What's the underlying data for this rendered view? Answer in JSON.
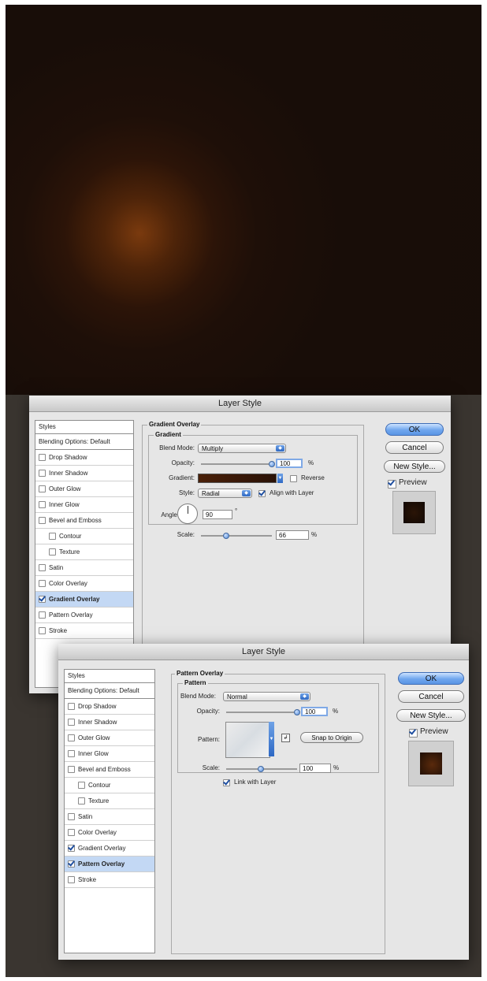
{
  "dialog1": {
    "title": "Layer Style",
    "sidebar": {
      "header": "Styles",
      "blending": "Blending Options: Default",
      "items": [
        {
          "label": "Drop Shadow",
          "checked": false
        },
        {
          "label": "Inner Shadow",
          "checked": false
        },
        {
          "label": "Outer Glow",
          "checked": false
        },
        {
          "label": "Inner Glow",
          "checked": false
        },
        {
          "label": "Bevel and Emboss",
          "checked": false
        },
        {
          "label": "Contour",
          "checked": false
        },
        {
          "label": "Texture",
          "checked": false
        },
        {
          "label": "Satin",
          "checked": false
        },
        {
          "label": "Color Overlay",
          "checked": false
        },
        {
          "label": "Gradient Overlay",
          "checked": true
        },
        {
          "label": "Pattern Overlay",
          "checked": false
        },
        {
          "label": "Stroke",
          "checked": false
        }
      ]
    },
    "section_title": "Gradient Overlay",
    "subsection_title": "Gradient",
    "blend_mode_label": "Blend Mode:",
    "blend_mode_value": "Multiply",
    "opacity_label": "Opacity:",
    "opacity_value": "100",
    "percent": "%",
    "gradient_label": "Gradient:",
    "reverse_label": "Reverse",
    "style_label": "Style:",
    "style_value": "Radial",
    "align_label": "Align with Layer",
    "angle_label": "Angle:",
    "angle_value": "90",
    "degree": "°",
    "scale_label": "Scale:",
    "scale_value": "66",
    "ok_label": "OK",
    "cancel_label": "Cancel",
    "new_style_label": "New Style...",
    "preview_label": "Preview"
  },
  "dialog2": {
    "title": "Layer Style",
    "sidebar": {
      "header": "Styles",
      "blending": "Blending Options: Default",
      "items": [
        {
          "label": "Drop Shadow",
          "checked": false
        },
        {
          "label": "Inner Shadow",
          "checked": false
        },
        {
          "label": "Outer Glow",
          "checked": false
        },
        {
          "label": "Inner Glow",
          "checked": false
        },
        {
          "label": "Bevel and Emboss",
          "checked": false
        },
        {
          "label": "Contour",
          "checked": false
        },
        {
          "label": "Texture",
          "checked": false
        },
        {
          "label": "Satin",
          "checked": false
        },
        {
          "label": "Color Overlay",
          "checked": false
        },
        {
          "label": "Gradient Overlay",
          "checked": true
        },
        {
          "label": "Pattern Overlay",
          "checked": true
        },
        {
          "label": "Stroke",
          "checked": false
        }
      ]
    },
    "section_title": "Pattern Overlay",
    "subsection_title": "Pattern",
    "blend_mode_label": "Blend Mode:",
    "blend_mode_value": "Normal",
    "opacity_label": "Opacity:",
    "opacity_value": "100",
    "percent": "%",
    "pattern_label": "Pattern:",
    "snap_label": "Snap to Origin",
    "scale_label": "Scale:",
    "scale_value": "100",
    "link_label": "Link with Layer",
    "ok_label": "OK",
    "cancel_label": "Cancel",
    "new_style_label": "New Style...",
    "preview_label": "Preview"
  },
  "colors": {
    "artwork_glow": "#7a3a0e",
    "artwork_bg": "#170d08",
    "selection": "#c3d8f4",
    "default_button": "#6fa6ee",
    "checkbox_mark": "#1f4fa0"
  },
  "icons": {
    "gradient_dropdown": "triangle-down-icon",
    "select_arrows": "up-down-arrows-icon",
    "checkbox": "checkmark-icon",
    "pattern_new": "new-preset-icon"
  }
}
